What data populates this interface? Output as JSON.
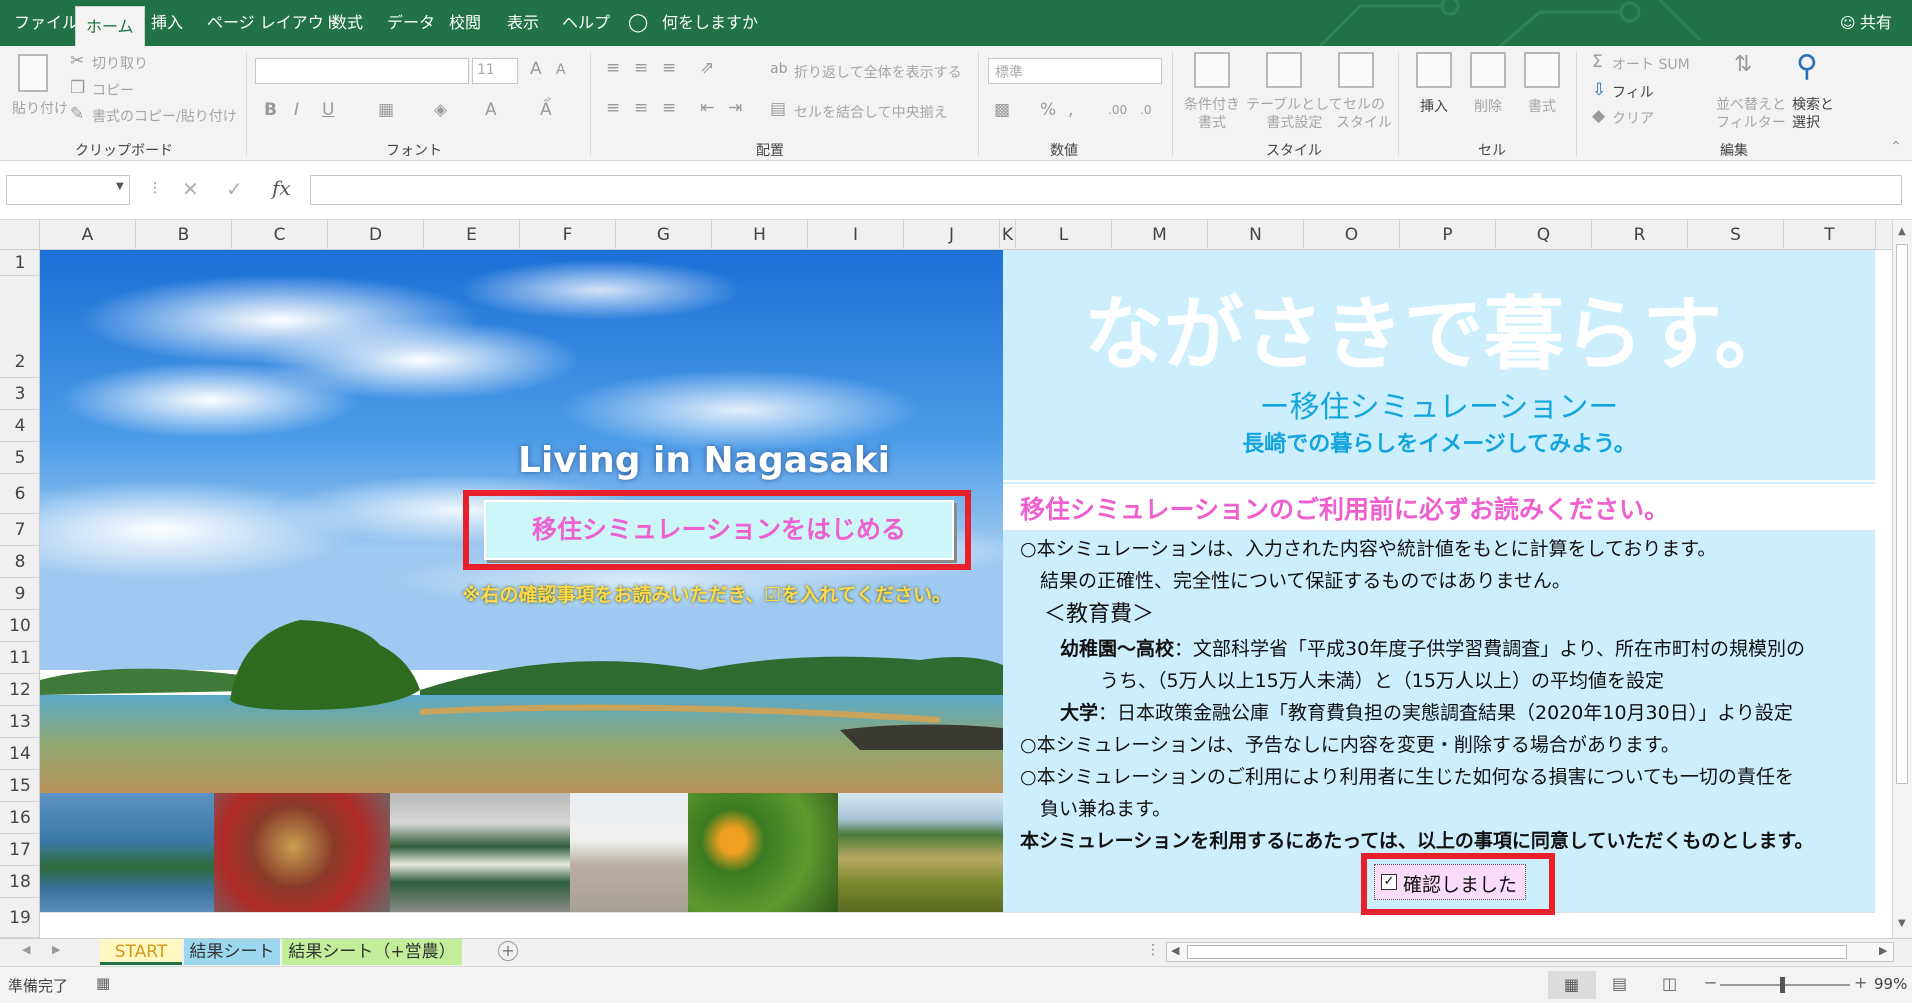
{
  "menu": {
    "file": "ファイル",
    "home": "ホーム",
    "insert": "挿入",
    "page_layout": "ページ レイアウト",
    "formulas": "数式",
    "data": "データ",
    "review": "校閲",
    "view": "表示",
    "help": "ヘルプ",
    "tell_me": "何をしますか",
    "share": "共有"
  },
  "ribbon": {
    "clipboard": {
      "paste": "貼り付け",
      "cut": "切り取り",
      "copy": "コピー",
      "format_painter": "書式のコピー/貼り付け",
      "label": "クリップボード"
    },
    "font": {
      "size": "11",
      "bold": "B",
      "italic": "I",
      "underline": "U",
      "label": "フォント"
    },
    "alignment": {
      "wrap": "折り返して全体を表示する",
      "merge": "セルを結合して中央揃え",
      "label": "配置"
    },
    "number": {
      "format": "標準",
      "label": "数値"
    },
    "styles": {
      "conditional": "条件付き\n書式",
      "table": "テーブルとして\n書式設定",
      "cell": "セルの\nスタイル",
      "label": "スタイル"
    },
    "cells": {
      "insert": "挿入",
      "delete": "削除",
      "format": "書式",
      "label": "セル"
    },
    "editing": {
      "autosum": "オート SUM",
      "fill": "フィル",
      "clear": "クリア",
      "sort": "並べ替えと\nフィルター",
      "find": "検索と\n選択",
      "label": "編集"
    }
  },
  "formula_bar": {
    "name_box": "",
    "fx": "fx",
    "value": ""
  },
  "columns": [
    "A",
    "B",
    "C",
    "D",
    "E",
    "F",
    "G",
    "H",
    "I",
    "J",
    "K",
    "L",
    "M",
    "N",
    "O",
    "P",
    "Q",
    "R",
    "S",
    "T"
  ],
  "rows": [
    "1",
    "2",
    "3",
    "4",
    "5",
    "6",
    "7",
    "8",
    "9",
    "10",
    "11",
    "12",
    "13",
    "14",
    "15",
    "16",
    "17",
    "18",
    "19"
  ],
  "sheet": {
    "living": "Living in Nagasaki",
    "start_button": "移住シミュレーションをはじめる",
    "notice": "※右の確認事項をお読みいただき、☑を入れてください。",
    "title": "ながさきで暮らす。",
    "subtitle": "ー移住シミュレーションー",
    "tagline": "長崎での暮らしをイメージしてみよう。",
    "read_first": "移住シミュレーションのご利用前に必ずお読みください。",
    "line1": "○本シミュレーションは、入力された内容や統計値をもとに計算をしております。",
    "line2": "結果の正確性、完全性について保証するものではありません。",
    "line3": "＜教育費＞",
    "line4_label": "幼稚園～高校",
    "line4": "：文部科学省「平成30年度子供学習費調査」より、所在市町村の規模別の",
    "line5": "うち、（5万人以上15万人未満）と（15万人以上）の平均値を設定",
    "line6_label": "大学",
    "line6": "：日本政策金融公庫「教育費負担の実態調査結果（2020年10月30日）」より設定",
    "line7": "○本シミュレーションは、予告なしに内容を変更・削除する場合があります。",
    "line8": "○本シミュレーションのご利用により利用者に生じた如何なる損害についても一切の責任を",
    "line9": "負い兼ねます。",
    "line10": "本シミュレーションを利用するにあたっては、以上の事項に同意していただくものとします。",
    "checkbox_label": "確認しました"
  },
  "checkbox": {
    "checked": true
  },
  "sheet_tabs": [
    "START",
    "結果シート",
    "結果シート（+営農）"
  ],
  "status": {
    "ready": "準備完了",
    "zoom": "99%"
  },
  "colors": {
    "excel_green": "#217346",
    "right_panel": "#cdeffd",
    "pink_text": "#ee5fcf",
    "highlight_red": "#e8202a",
    "blue_text": "#15a5dd"
  }
}
